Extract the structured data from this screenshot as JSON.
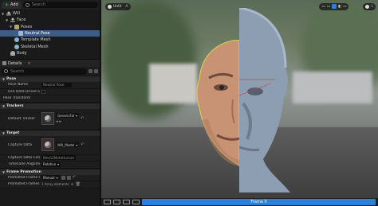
{
  "outliner": {
    "add_label": "Add",
    "search_placeholder": "Search",
    "items": [
      {
        "label": "Will",
        "depth": 0,
        "icon": "person-icon",
        "selected": false
      },
      {
        "label": "Face",
        "depth": 1,
        "icon": "person-icon",
        "selected": false
      },
      {
        "label": "Poses",
        "depth": 2,
        "icon": "folder-icon",
        "selected": false
      },
      {
        "label": "Neutral Pose",
        "depth": 3,
        "icon": "pose-icon",
        "selected": true
      },
      {
        "label": "Template Mesh",
        "depth": 2,
        "icon": "mesh-icon",
        "selected": false
      },
      {
        "label": "Skeletal Mesh",
        "depth": 2,
        "icon": "mesh-icon",
        "selected": false
      },
      {
        "label": "Body",
        "depth": 1,
        "icon": "body-icon",
        "selected": false
      }
    ]
  },
  "details": {
    "tab_label": "Details",
    "search_placeholder": "Search",
    "sections": {
      "pose": "Pose",
      "trackers": "Trackers",
      "target": "Target",
      "frame_promotion": "Frame Promotion"
    },
    "rows": {
      "pose_name": {
        "label": "Pose Name",
        "value": "Neutral Pose"
      },
      "use_data_driven": {
        "label": "Use Data Driven E..."
      },
      "pose_transform": {
        "label": "Pose Transform"
      },
      "default_tracker": {
        "label": "Default Tracker",
        "value": "GenericFal"
      },
      "capture_data": {
        "label": "Capture Data",
        "value": "Will_Model"
      },
      "capture_data_config": {
        "label": "Capture Data Config",
        "value": "Mesh2MetaHuman"
      },
      "timecode_alignment": {
        "label": "Timecode Alignme...",
        "value": "Relative"
      },
      "promoted_frame": {
        "label": "Promoted Frame C...",
        "value": "Manual"
      },
      "promoted_frames": {
        "label": "Promoted Frames",
        "value": "1 Array elements"
      }
    }
  },
  "viewport": {
    "unlit_label": "Unlit",
    "frame_label": "Frame 0"
  },
  "colors": {
    "selection": "#3b5d87",
    "accent": "#2d7fdc",
    "panel": "#1a1a1a"
  }
}
